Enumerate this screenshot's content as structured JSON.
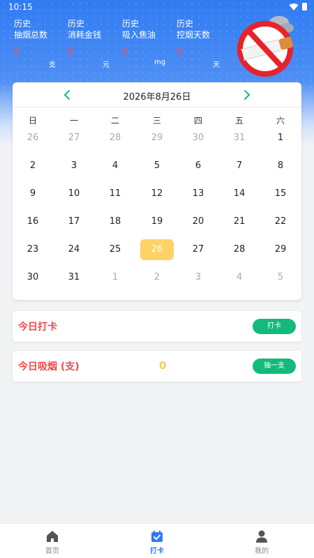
{
  "status_bar": {
    "time": "10:15"
  },
  "stats": [
    {
      "line1": "历史",
      "line2": "抽烟总数",
      "value": "0",
      "unit": "支"
    },
    {
      "line1": "历史",
      "line2": "消耗金钱",
      "value": "0",
      "unit": "元"
    },
    {
      "line1": "历史",
      "line2": "吸入焦油",
      "value": "0",
      "unit": "mg"
    },
    {
      "line1": "历史",
      "line2": "控烟天数",
      "value": "0",
      "unit": "天"
    }
  ],
  "calendar": {
    "title": "2026年8月26日",
    "weekdays": [
      "日",
      "一",
      "二",
      "三",
      "四",
      "五",
      "六"
    ],
    "weeks": [
      [
        "26",
        "27",
        "28",
        "29",
        "30",
        "31",
        "1"
      ],
      [
        "2",
        "3",
        "4",
        "5",
        "6",
        "7",
        "8"
      ],
      [
        "9",
        "10",
        "11",
        "12",
        "13",
        "14",
        "15"
      ],
      [
        "16",
        "17",
        "18",
        "19",
        "20",
        "21",
        "22"
      ],
      [
        "23",
        "24",
        "25",
        "26",
        "27",
        "28",
        "29"
      ],
      [
        "30",
        "31",
        "1",
        "2",
        "3",
        "4",
        "5"
      ]
    ],
    "today": "26"
  },
  "checkin_card": {
    "label": "今日打卡",
    "button": "打卡"
  },
  "smoke_card": {
    "label": "今日吸烟 (支)",
    "count": "0",
    "button": "抽一支"
  },
  "bottom_nav": [
    {
      "label": "首页",
      "icon": "home-icon",
      "active": false
    },
    {
      "label": "打卡",
      "icon": "calendar-check-icon",
      "active": true
    },
    {
      "label": "我的",
      "icon": "user-icon",
      "active": false
    }
  ],
  "colors": {
    "header_blue": "#2f7bf2",
    "stat_value_red": "#ff4d4f",
    "accent_green": "#13ba7c",
    "today_yellow": "#ffd166",
    "label_red": "#f04a4a"
  }
}
